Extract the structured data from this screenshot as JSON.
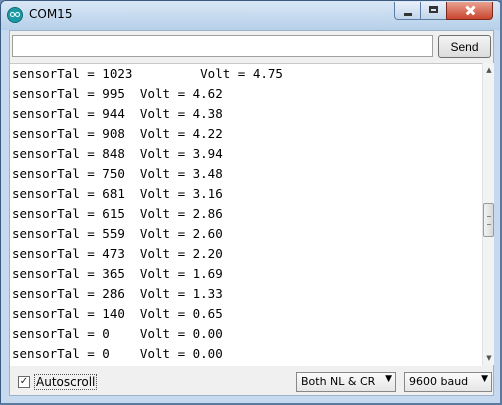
{
  "window": {
    "title": "COM15"
  },
  "toolbar": {
    "send_label": "Send",
    "input_value": ""
  },
  "output": {
    "lines": [
      "sensorTal = 1023         Volt = 4.75",
      "sensorTal = 995  Volt = 4.62",
      "sensorTal = 944  Volt = 4.38",
      "sensorTal = 908  Volt = 4.22",
      "sensorTal = 848  Volt = 3.94",
      "sensorTal = 750  Volt = 3.48",
      "sensorTal = 681  Volt = 3.16",
      "sensorTal = 615  Volt = 2.86",
      "sensorTal = 559  Volt = 2.60",
      "sensorTal = 473  Volt = 2.20",
      "sensorTal = 365  Volt = 1.69",
      "sensorTal = 286  Volt = 1.33",
      "sensorTal = 140  Volt = 0.65",
      "sensorTal = 0    Volt = 0.00",
      "sensorTal = 0    Volt = 0.00"
    ]
  },
  "footer": {
    "autoscroll_label": "Autoscroll",
    "autoscroll_checked": true,
    "line_ending": "Both NL & CR",
    "baud_rate": "9600 baud"
  },
  "icons": {
    "app": "arduino-icon",
    "minimize": "minimize-icon",
    "maximize": "maximize-icon",
    "close": "close-icon",
    "dropdown": "chevron-down-icon",
    "check": "checkmark-icon"
  },
  "colors": {
    "titlebar": "#c7d9ee",
    "close_button": "#c9452e",
    "app_icon": "#1b9aa6"
  }
}
